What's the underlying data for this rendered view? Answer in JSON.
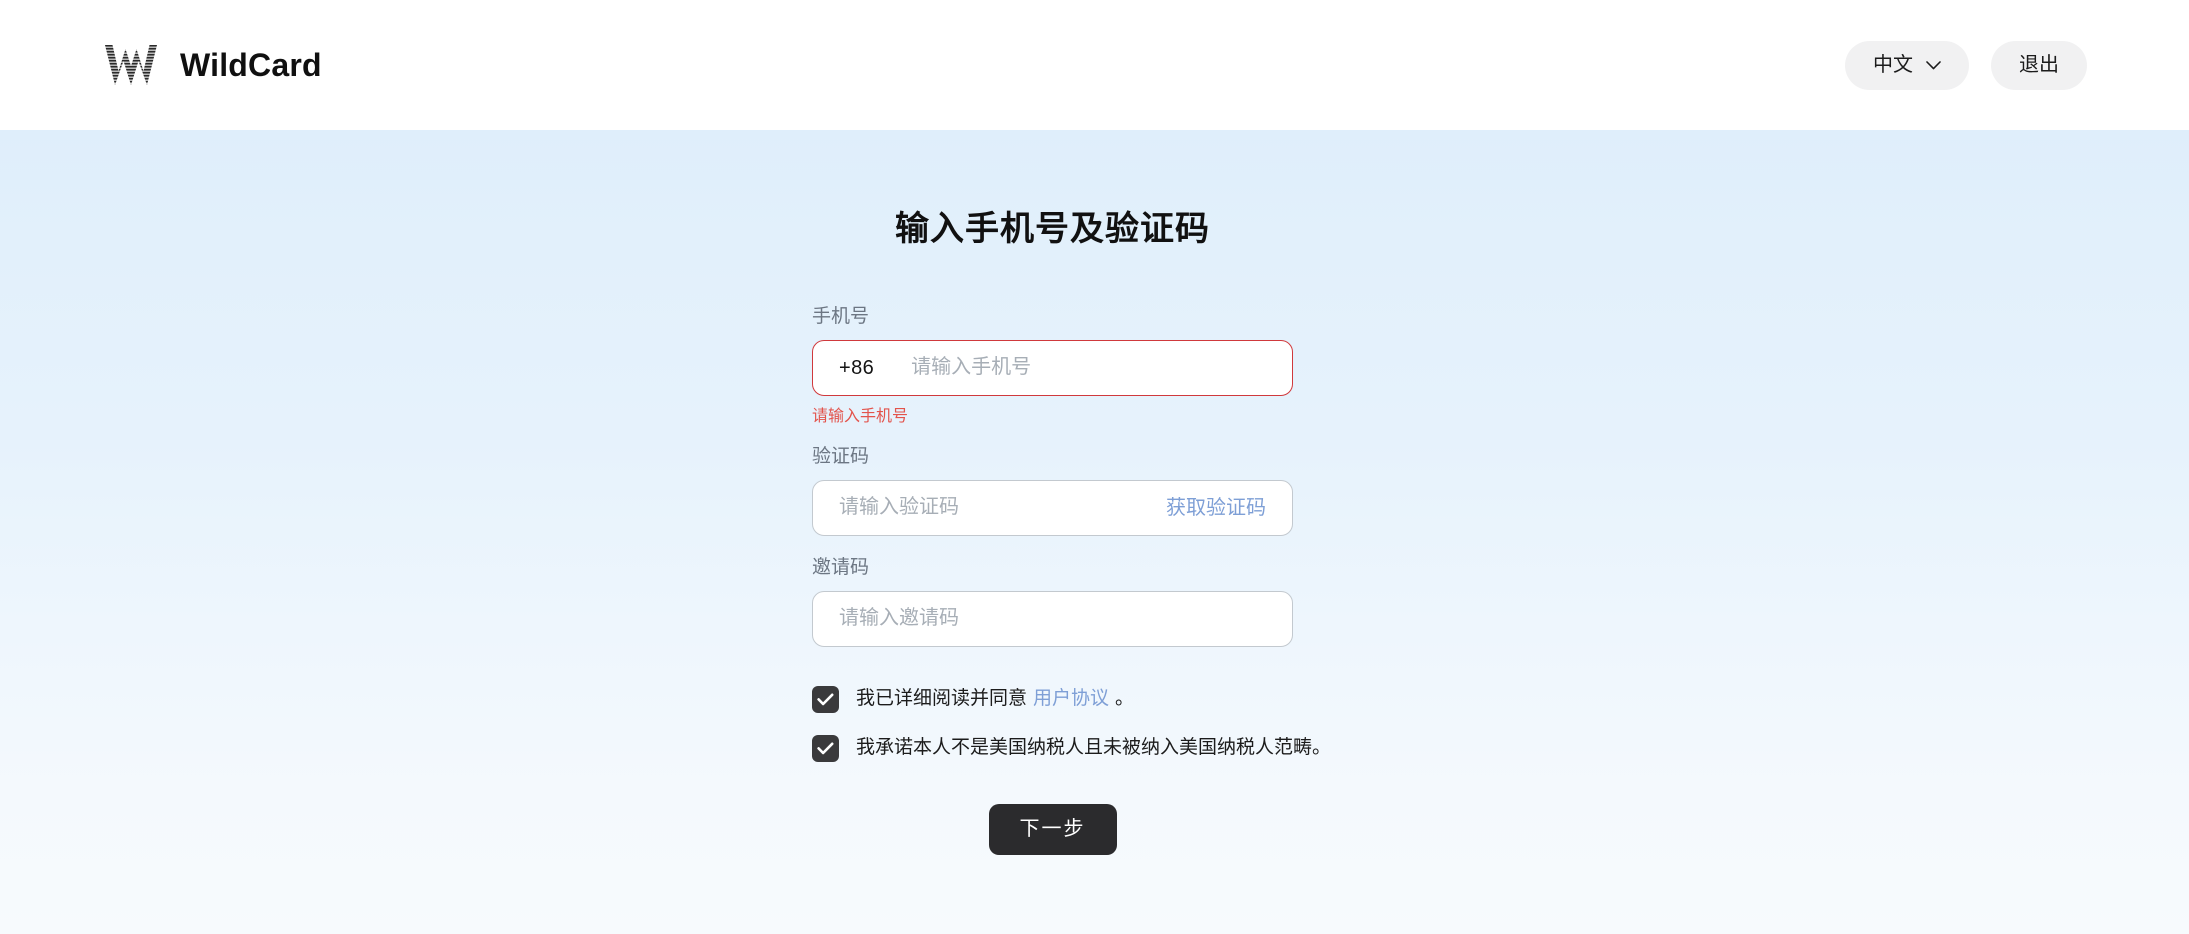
{
  "header": {
    "brand_name": "WildCard",
    "logo_icon": "wildcard-w-logo",
    "language_label": "中文",
    "language_chevron_icon": "chevron-down-icon",
    "logout_label": "退出"
  },
  "main": {
    "title": "输入手机号及验证码",
    "phone": {
      "label": "手机号",
      "country_code": "+86",
      "placeholder": "请输入手机号",
      "value": "",
      "error": "请输入手机号",
      "has_error": true
    },
    "verification": {
      "label": "验证码",
      "placeholder": "请输入验证码",
      "value": "",
      "send_code_label": "获取验证码"
    },
    "invite": {
      "label": "邀请码",
      "placeholder": "请输入邀请码",
      "value": ""
    },
    "agreements": [
      {
        "checked": true,
        "text_before": "我已详细阅读并同意",
        "link_text": "用户协议",
        "text_after": "。"
      },
      {
        "checked": true,
        "text_before": "我承诺本人不是美国纳税人且未被纳入美国纳税人范畴。",
        "link_text": "",
        "text_after": ""
      }
    ],
    "submit_label": "下一步"
  },
  "colors": {
    "accent_link": "#7e9fd6",
    "error": "#e3534b",
    "error_border": "#d0393c",
    "button_dark": "#2b2b2d",
    "checkbox_dark": "#3a3a3c",
    "bg_gradient_top": "#dfeefb",
    "bg_gradient_bottom": "#f7fafd",
    "pill_bg": "#f1f1f2"
  }
}
